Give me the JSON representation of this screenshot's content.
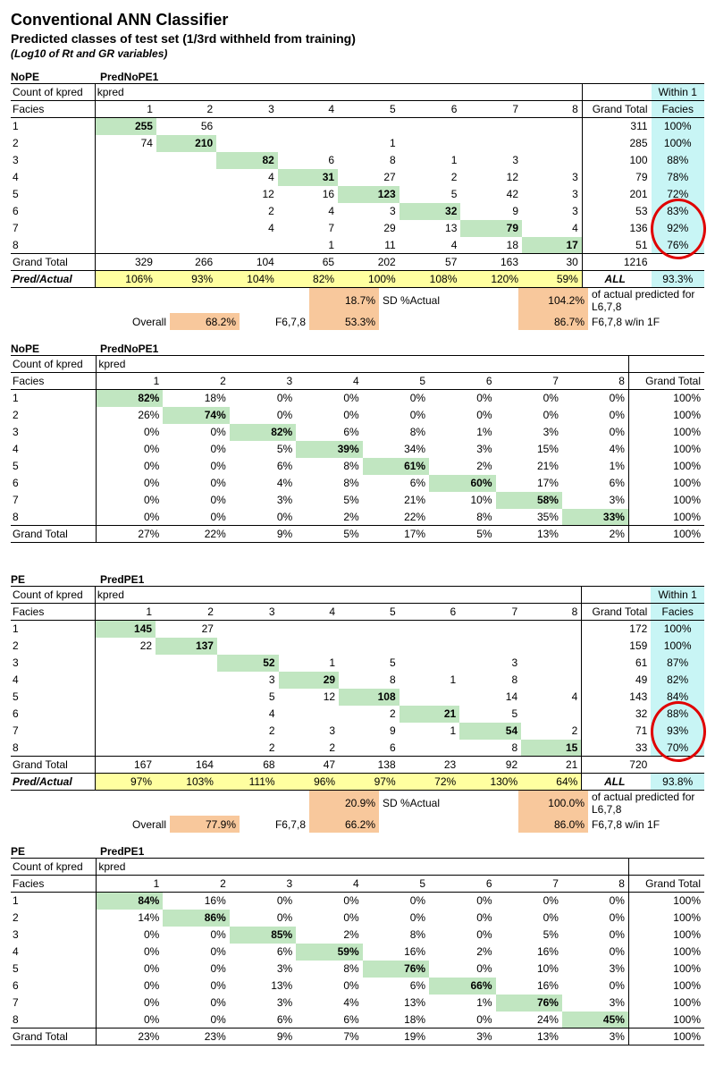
{
  "titles": {
    "t1": "Conventional ANN Classifier",
    "t2": "Predicted classes of test set (1/3rd withheld from training)",
    "t3": "(Log10 of Rt and GR variables)"
  },
  "labels": {
    "count": "Count of kpred",
    "kpred": "kpred",
    "facies": "Facies",
    "gt": "Grand Total",
    "wf1": "Within 1",
    "wf2": "Facies",
    "pa": "Pred/Actual",
    "all": "ALL",
    "sd": "SD %Actual",
    "ov": "Overall",
    "f678": "F6,7,8",
    "ap": "of actual predicted for L6,7,8",
    "fw": "F6,7,8 w/in 1F"
  },
  "cols": [
    "1",
    "2",
    "3",
    "4",
    "5",
    "6",
    "7",
    "8"
  ],
  "blocks": [
    {
      "tag": "NoPE",
      "pred": "PredNoPE1",
      "counts": {
        "rows": [
          [
            "255",
            "56",
            "",
            "",
            "",
            "",
            "",
            ""
          ],
          [
            "74",
            "210",
            "",
            "",
            "1",
            "",
            "",
            ""
          ],
          [
            "",
            "",
            "82",
            "6",
            "8",
            "1",
            "3",
            ""
          ],
          [
            "",
            "",
            "4",
            "31",
            "27",
            "2",
            "12",
            "3"
          ],
          [
            "",
            "",
            "12",
            "16",
            "123",
            "5",
            "42",
            "3"
          ],
          [
            "",
            "",
            "2",
            "4",
            "3",
            "32",
            "9",
            "3"
          ],
          [
            "",
            "",
            "4",
            "7",
            "29",
            "13",
            "79",
            "4"
          ],
          [
            "",
            "",
            "",
            "1",
            "11",
            "4",
            "18",
            "17"
          ]
        ],
        "rowGT": [
          "311",
          "285",
          "100",
          "79",
          "201",
          "53",
          "136",
          "51"
        ],
        "wf": [
          "100%",
          "100%",
          "88%",
          "78%",
          "72%",
          "83%",
          "92%",
          "76%"
        ],
        "colGT": [
          "329",
          "266",
          "104",
          "65",
          "202",
          "57",
          "163",
          "30"
        ],
        "total": "1216",
        "pa": [
          "106%",
          "93%",
          "104%",
          "82%",
          "100%",
          "108%",
          "120%",
          "59%"
        ],
        "wfAll": "93.3%",
        "ov": "68.2%",
        "f678": "53.3%",
        "sdv": "18.7%",
        "apv": "104.2%",
        "fwv": "86.7%"
      },
      "pct": {
        "rows": [
          [
            "82%",
            "18%",
            "0%",
            "0%",
            "0%",
            "0%",
            "0%",
            "0%"
          ],
          [
            "26%",
            "74%",
            "0%",
            "0%",
            "0%",
            "0%",
            "0%",
            "0%"
          ],
          [
            "0%",
            "0%",
            "82%",
            "6%",
            "8%",
            "1%",
            "3%",
            "0%"
          ],
          [
            "0%",
            "0%",
            "5%",
            "39%",
            "34%",
            "3%",
            "15%",
            "4%"
          ],
          [
            "0%",
            "0%",
            "6%",
            "8%",
            "61%",
            "2%",
            "21%",
            "1%"
          ],
          [
            "0%",
            "0%",
            "4%",
            "8%",
            "6%",
            "60%",
            "17%",
            "6%"
          ],
          [
            "0%",
            "0%",
            "3%",
            "5%",
            "21%",
            "10%",
            "58%",
            "3%"
          ],
          [
            "0%",
            "0%",
            "0%",
            "2%",
            "22%",
            "8%",
            "35%",
            "33%"
          ]
        ],
        "rowGT": [
          "100%",
          "100%",
          "100%",
          "100%",
          "100%",
          "100%",
          "100%",
          "100%"
        ],
        "colGT": [
          "27%",
          "22%",
          "9%",
          "5%",
          "17%",
          "5%",
          "13%",
          "2%"
        ],
        "total": "100%"
      },
      "circle_start": 5
    },
    {
      "tag": "PE",
      "pred": "PredPE1",
      "counts": {
        "rows": [
          [
            "145",
            "27",
            "",
            "",
            "",
            "",
            "",
            ""
          ],
          [
            "22",
            "137",
            "",
            "",
            "",
            "",
            "",
            ""
          ],
          [
            "",
            "",
            "52",
            "1",
            "5",
            "",
            "3",
            ""
          ],
          [
            "",
            "",
            "3",
            "29",
            "8",
            "1",
            "8",
            ""
          ],
          [
            "",
            "",
            "5",
            "12",
            "108",
            "",
            "14",
            "4"
          ],
          [
            "",
            "",
            "4",
            "",
            "2",
            "21",
            "5",
            ""
          ],
          [
            "",
            "",
            "2",
            "3",
            "9",
            "1",
            "54",
            "2"
          ],
          [
            "",
            "",
            "2",
            "2",
            "6",
            "",
            "8",
            "15"
          ]
        ],
        "rowGT": [
          "172",
          "159",
          "61",
          "49",
          "143",
          "32",
          "71",
          "33"
        ],
        "wf": [
          "100%",
          "100%",
          "87%",
          "82%",
          "84%",
          "88%",
          "93%",
          "70%"
        ],
        "colGT": [
          "167",
          "164",
          "68",
          "47",
          "138",
          "23",
          "92",
          "21"
        ],
        "total": "720",
        "pa": [
          "97%",
          "103%",
          "111%",
          "96%",
          "97%",
          "72%",
          "130%",
          "64%"
        ],
        "wfAll": "93.8%",
        "ov": "77.9%",
        "f678": "66.2%",
        "sdv": "20.9%",
        "apv": "100.0%",
        "fwv": "86.0%"
      },
      "pct": {
        "rows": [
          [
            "84%",
            "16%",
            "0%",
            "0%",
            "0%",
            "0%",
            "0%",
            "0%"
          ],
          [
            "14%",
            "86%",
            "0%",
            "0%",
            "0%",
            "0%",
            "0%",
            "0%"
          ],
          [
            "0%",
            "0%",
            "85%",
            "2%",
            "8%",
            "0%",
            "5%",
            "0%"
          ],
          [
            "0%",
            "0%",
            "6%",
            "59%",
            "16%",
            "2%",
            "16%",
            "0%"
          ],
          [
            "0%",
            "0%",
            "3%",
            "8%",
            "76%",
            "0%",
            "10%",
            "3%"
          ],
          [
            "0%",
            "0%",
            "13%",
            "0%",
            "6%",
            "66%",
            "16%",
            "0%"
          ],
          [
            "0%",
            "0%",
            "3%",
            "4%",
            "13%",
            "1%",
            "76%",
            "3%"
          ],
          [
            "0%",
            "0%",
            "6%",
            "6%",
            "18%",
            "0%",
            "24%",
            "45%"
          ]
        ],
        "rowGT": [
          "100%",
          "100%",
          "100%",
          "100%",
          "100%",
          "100%",
          "100%",
          "100%"
        ],
        "colGT": [
          "23%",
          "23%",
          "9%",
          "7%",
          "19%",
          "3%",
          "13%",
          "3%"
        ],
        "total": "100%"
      },
      "circle_start": 5
    }
  ]
}
